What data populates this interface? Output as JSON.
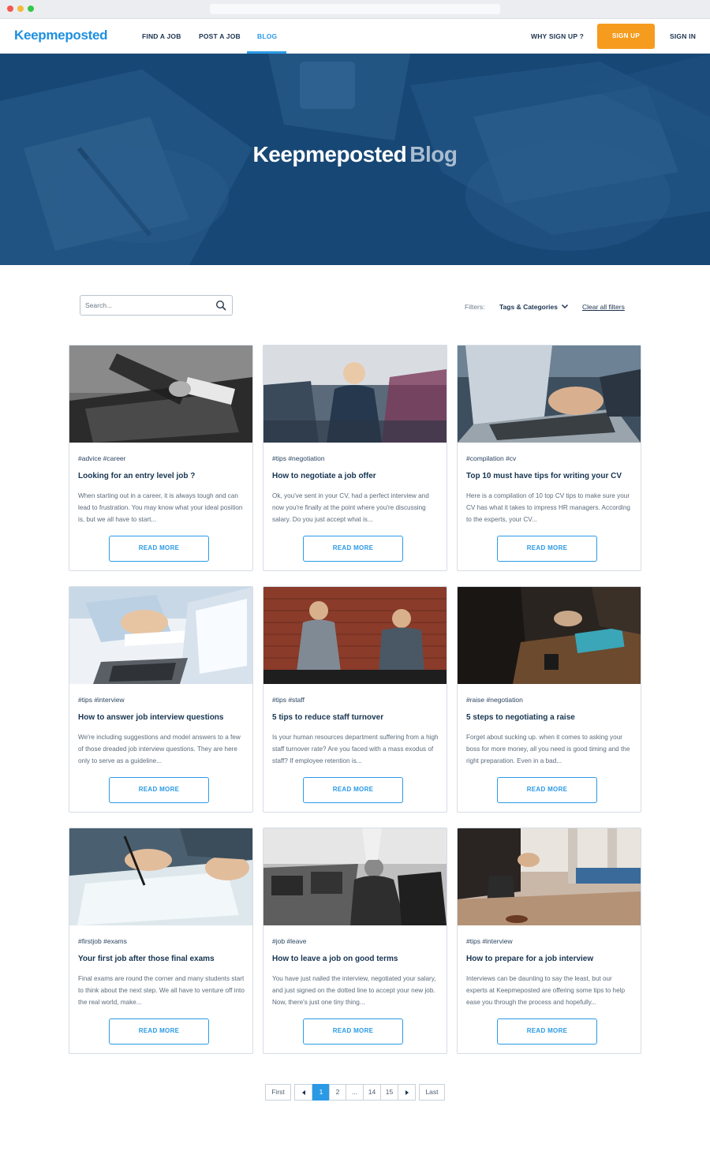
{
  "nav": {
    "logo": "Keepmeposted",
    "links": [
      "FIND A JOB",
      "POST A JOB",
      "BLOG"
    ],
    "why": "WHY SIGN UP ?",
    "signup": "SIGN UP",
    "signin": "SIGN IN"
  },
  "hero": {
    "title_main": "Keepmeposted",
    "title_accent": "Blog"
  },
  "search": {
    "placeholder": "Search..."
  },
  "filters": {
    "label": "Filters:",
    "dropdown": "Tags & Categories",
    "clear": "Clear all filters"
  },
  "cards": [
    {
      "tags": "#advice #career",
      "title": "Looking for an entry level job ?",
      "excerpt": "When starting out in a career, it is always tough and can lead to frustration. You may know what your ideal position is, but we all have to start...",
      "button": "READ MORE"
    },
    {
      "tags": "#tips #negotiation",
      "title": "How to negotiate a job offer",
      "excerpt": "Ok, you've sent in your CV, had a perfect interview and now you're finally at the point where you're discussing salary. Do you just accept what is...",
      "button": "READ MORE"
    },
    {
      "tags": "#compilation #cv",
      "title": "Top 10 must have tips for writing your CV",
      "excerpt": "Here is a compilation of 10 top CV tips to make sure your CV has what it takes to impress HR managers. According to the experts, your CV...",
      "button": "READ MORE"
    },
    {
      "tags": "#tips #interview",
      "title": "How to answer job interview questions",
      "excerpt": "We're including suggestions and model answers to a few of those dreaded job interview questions. They are here only to serve as a guideline...",
      "button": "READ MORE"
    },
    {
      "tags": "#tips #staff",
      "title": "5 tips to reduce staff turnover",
      "excerpt": "Is your human resources department suffering from a high staff turnover rate? Are you faced with a mass exodus of staff? If employee retention is...",
      "button": "READ MORE"
    },
    {
      "tags": "#raise #negotiation",
      "title": "5 steps to negotiating a raise",
      "excerpt": "Forget about sucking up. when it comes to asking your boss for more money, all you need is good timing and the right preparation. Even in a bad...",
      "button": "READ MORE"
    },
    {
      "tags": "#firstjob #exams",
      "title": "Your first job after those final exams",
      "excerpt": "Final exams are round the corner and many students start to think about the next step. We all have to venture off into the real world, make...",
      "button": "READ MORE"
    },
    {
      "tags": "#job #leave",
      "title": "How to leave a job on good terms",
      "excerpt": "You have just nailed the interview, negotiated your salary, and just signed on the dotted line to accept your new job. Now, there's just one tiny thing...",
      "button": "READ MORE"
    },
    {
      "tags": "#tips #interview",
      "title": "How to prepare for a job interview",
      "excerpt": "Interviews can be daunting to say the least, but our experts at Keepmeposted are offering some tips to help ease you through the process and hopefully...",
      "button": "READ MORE"
    }
  ],
  "pagination": {
    "first": "First",
    "pages": [
      "1",
      "2",
      "...",
      "14",
      "15"
    ],
    "last": "Last",
    "current": "1"
  },
  "colors": {
    "primary": "#2a9ae6",
    "accent": "#f59b1e",
    "hero": "#1a4d7c",
    "navy": "#163450"
  }
}
